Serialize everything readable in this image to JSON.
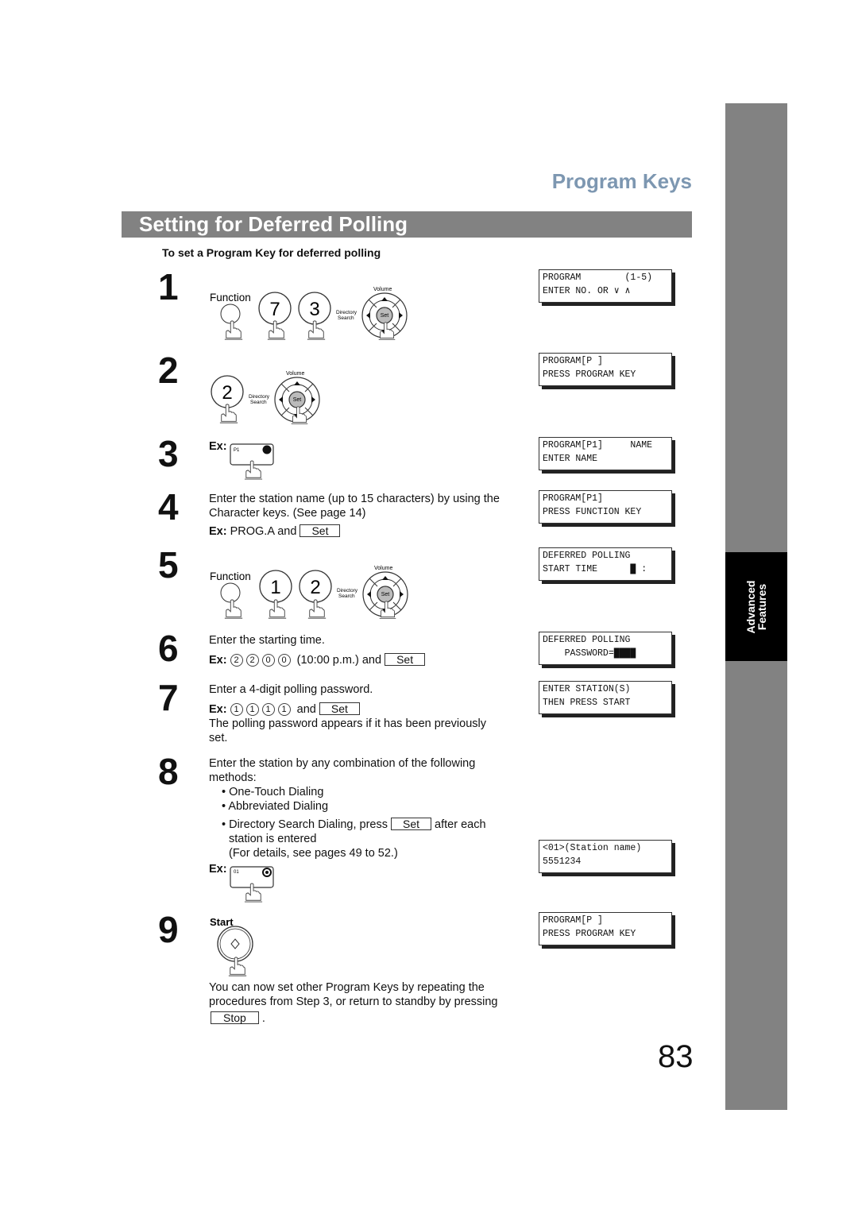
{
  "header": {
    "section": "Program Keys",
    "title": "Setting for Deferred Polling",
    "subtitle": "To set a Program Key for deferred polling"
  },
  "side_tab": {
    "line1": "Advanced",
    "line2": "Features"
  },
  "keys": {
    "function": "Function",
    "volume": "Volume",
    "dir1": "Directory",
    "dir2": "Search",
    "set": "Set",
    "start": "Start",
    "stop": "Stop",
    "p1": "P1",
    "one_touch_01": "01"
  },
  "steps": [
    {
      "num": "1",
      "digits": [
        "7",
        "3"
      ],
      "lcd": [
        "PROGRAM        (1-5)",
        "ENTER NO. OR ∨ ∧"
      ]
    },
    {
      "num": "2",
      "digits": [
        "2"
      ],
      "lcd": [
        "PROGRAM[P ]",
        "PRESS PROGRAM KEY"
      ]
    },
    {
      "num": "3",
      "ex": "Ex:",
      "lcd": [
        "PROGRAM[P1]     NAME",
        "ENTER NAME"
      ]
    },
    {
      "num": "4",
      "text1": "Enter the station name (up to 15 characters) by using the",
      "text2": "Character keys.  (See page 14)",
      "ex": "Ex:",
      "ex_value": "PROG.A and",
      "lcd": [
        "PROGRAM[P1]",
        "PRESS FUNCTION KEY"
      ]
    },
    {
      "num": "5",
      "digits": [
        "1",
        "2"
      ],
      "lcd": [
        "DEFERRED POLLING",
        "START TIME      █ :"
      ]
    },
    {
      "num": "6",
      "text1": "Enter the starting time.",
      "ex": "Ex:",
      "ex_digits": [
        "2",
        "2",
        "0",
        "0"
      ],
      "ex_tail": "(10:00 p.m.) and",
      "lcd": [
        "DEFERRED POLLING",
        "    PASSWORD=████"
      ]
    },
    {
      "num": "7",
      "text1": "Enter a 4-digit polling password.",
      "ex": "Ex:",
      "ex_digits": [
        "1",
        "1",
        "1",
        "1"
      ],
      "ex_tail": "and",
      "text2": "The polling password appears if it has been previously",
      "text3": "set.",
      "lcd": [
        "ENTER STATION(S)",
        "THEN PRESS START"
      ]
    },
    {
      "num": "8",
      "text1": "Enter the station by any combination of the following",
      "text2": "methods:",
      "bullets": [
        "One-Touch Dialing",
        "Abbreviated Dialing",
        "Directory Search Dialing, press"
      ],
      "after_each": "after each",
      "text3": "station is entered",
      "text4": "(For details, see pages 49 to 52.)",
      "ex": "Ex:",
      "lcd": [
        "<01>(Station name)",
        "5551234"
      ]
    },
    {
      "num": "9",
      "text1": "You can now set other Program Keys by repeating the",
      "text2": "procedures from Step 3, or return to standby by pressing",
      "lcd": [
        "PROGRAM[P ]",
        "PRESS PROGRAM KEY"
      ]
    }
  ],
  "page_number": "83"
}
